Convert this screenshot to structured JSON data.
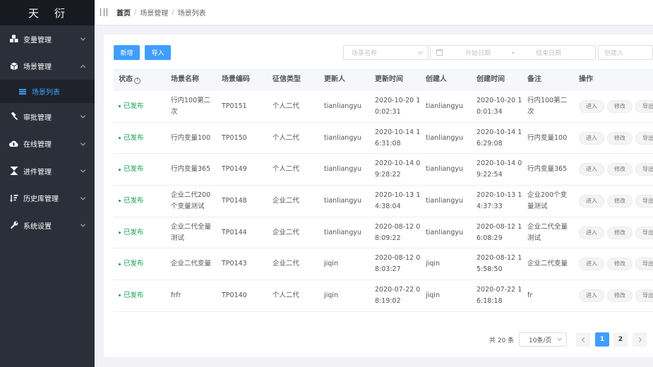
{
  "app": {
    "logo": "天衍"
  },
  "sidebar": {
    "items": [
      {
        "label": "变量管理",
        "icon": "cubes-icon"
      },
      {
        "label": "场景管理",
        "icon": "cube-icon",
        "expanded": true
      },
      {
        "label": "审批管理",
        "icon": "hammer-icon"
      },
      {
        "label": "在线管理",
        "icon": "cloud-upload-icon"
      },
      {
        "label": "进件管理",
        "icon": "hourglass-icon"
      },
      {
        "label": "历史库管理",
        "icon": "sort-list-icon"
      },
      {
        "label": "系统设置",
        "icon": "wrench-icon"
      }
    ],
    "sub_item": {
      "label": "场景列表",
      "icon": "list-icon"
    }
  },
  "breadcrumb": {
    "home": "首页",
    "level2": "场景管理",
    "level3": "场景列表"
  },
  "toolbar": {
    "new_label": "新增",
    "import_label": "导入"
  },
  "filters": {
    "scene_name_placeholder": "场景名称",
    "start_date_placeholder": "开始日期",
    "date_sep": "-",
    "end_date_placeholder": "结束日期",
    "creator_placeholder": "创建人"
  },
  "table": {
    "headers": [
      "状态",
      "场景名称",
      "场景编码",
      "征信类型",
      "更新人",
      "更新时间",
      "创建人",
      "创建时间",
      "备注",
      "操作"
    ],
    "status_help_icon": "?",
    "ops": [
      "进入",
      "修改",
      "导出"
    ],
    "rows": [
      {
        "status": "已发布",
        "name1": "行内100第二",
        "name2": "次",
        "code": "TP0151",
        "type": "个人二代",
        "updater": "tianliangyu",
        "upd1": "2020-10-20 1",
        "upd2": "0:02:31",
        "creator": "tianliangyu",
        "cre1": "2020-10-20 1",
        "cre2": "0:01:34",
        "note1": "行内100第二",
        "note2": "次"
      },
      {
        "status": "已发布",
        "name1": "行内变量100",
        "name2": "",
        "code": "TP0150",
        "type": "个人二代",
        "updater": "tianliangyu",
        "upd1": "2020-10-14 1",
        "upd2": "6:31:08",
        "creator": "tianliangyu",
        "cre1": "2020-10-14 1",
        "cre2": "6:29:08",
        "note1": "行内变量100",
        "note2": ""
      },
      {
        "status": "已发布",
        "name1": "行内变量365",
        "name2": "",
        "code": "TP0149",
        "type": "个人二代",
        "updater": "tianliangyu",
        "upd1": "2020-10-14 0",
        "upd2": "9:28:22",
        "creator": "tianliangyu",
        "cre1": "2020-10-14 0",
        "cre2": "9:22:54",
        "note1": "行内变量365",
        "note2": ""
      },
      {
        "status": "已发布",
        "name1": "企业二代200",
        "name2": "个变量测试",
        "code": "TP0148",
        "type": "企业二代",
        "updater": "tianliangyu",
        "upd1": "2020-10-13 1",
        "upd2": "4:38:04",
        "creator": "tianliangyu",
        "cre1": "2020-10-13 1",
        "cre2": "4:37:33",
        "note1": "企业200个变",
        "note2": "量测试"
      },
      {
        "status": "已发布",
        "name1": "企业二代全量",
        "name2": "测试",
        "code": "TP0144",
        "type": "企业二代",
        "updater": "tianliangyu",
        "upd1": "2020-08-12 0",
        "upd2": "8:09:22",
        "creator": "tianliangyu",
        "cre1": "2020-08-12 1",
        "cre2": "6:08:29",
        "note1": "企业二代全量",
        "note2": "测试"
      },
      {
        "status": "已发布",
        "name1": "企业二代变量",
        "name2": "",
        "code": "TP0143",
        "type": "企业二代",
        "updater": "jiqin",
        "upd1": "2020-08-12 0",
        "upd2": "8:03:27",
        "creator": "jiqin",
        "cre1": "2020-08-12 1",
        "cre2": "5:58:50",
        "note1": "企业二代变量",
        "note2": ""
      },
      {
        "status": "已发布",
        "name1": "frfr",
        "name2": "",
        "code": "TP0140",
        "type": "个人二代",
        "updater": "jiqin",
        "upd1": "2020-07-22 0",
        "upd2": "8:19:02",
        "creator": "jiqin",
        "cre1": "2020-07-22 1",
        "cre2": "6:18:18",
        "note1": "fr",
        "note2": ""
      }
    ]
  },
  "pagination": {
    "total": "共 20 条",
    "page_size": "10条/页",
    "pages": [
      "1",
      "2"
    ],
    "current": "1"
  },
  "colors": {
    "primary": "#409eff",
    "success": "#13a14e",
    "sidebar_bg": "#2b2f3a"
  }
}
